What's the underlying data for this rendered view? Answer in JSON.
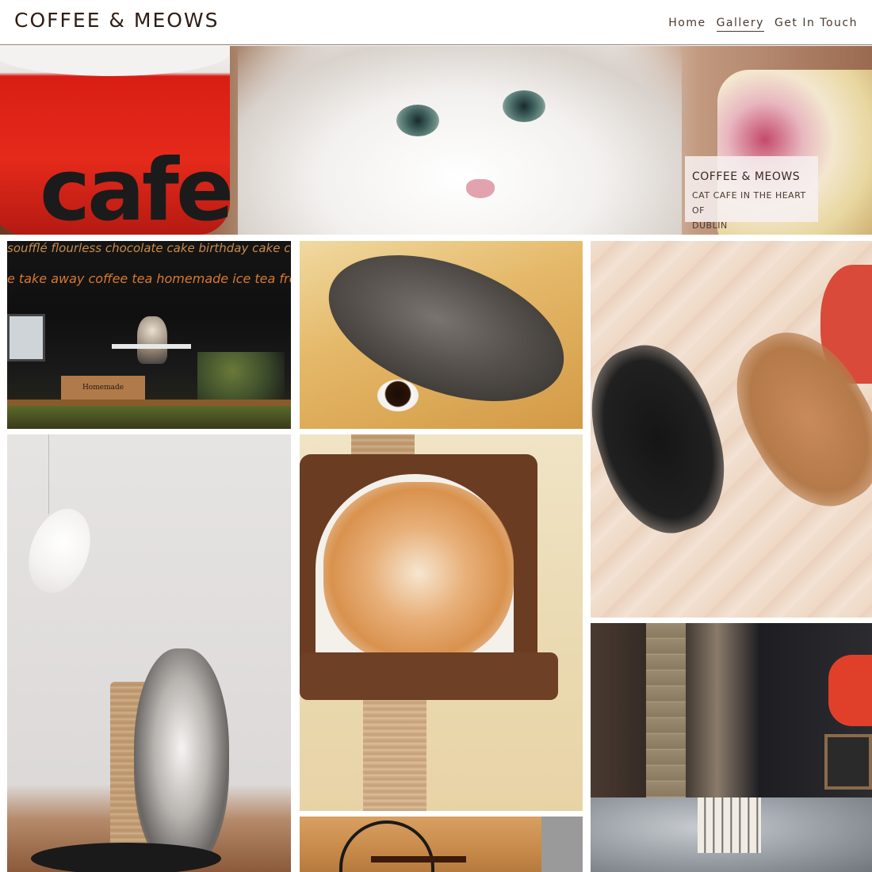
{
  "header": {
    "brand": "COFFEE & MEOWS",
    "nav": [
      {
        "label": "Home",
        "active": false
      },
      {
        "label": "Gallery",
        "active": true
      },
      {
        "label": "Get In Touch",
        "active": false
      }
    ]
  },
  "hero": {
    "cup_text": "cafe",
    "card_title": "COFFEE & MEOWS",
    "card_subtitle_line1": "CAT CAFE IN THE HEART OF",
    "card_subtitle_line2": "DUBLIN"
  },
  "gallery": {
    "window_sign_top": "soufflé   flourless   chocolate cake   birthday cake   cookies   quiche   ch",
    "window_sign_bottom": "e   take away coffee   tea   homemade ice tea   fresh orange juice   home",
    "crate_label": "Homemade"
  },
  "colors": {
    "text": "#3a2a20",
    "header_border": "#8a7a70",
    "sign_orange": "#d9782c",
    "cup_red": "#e52a1b"
  }
}
